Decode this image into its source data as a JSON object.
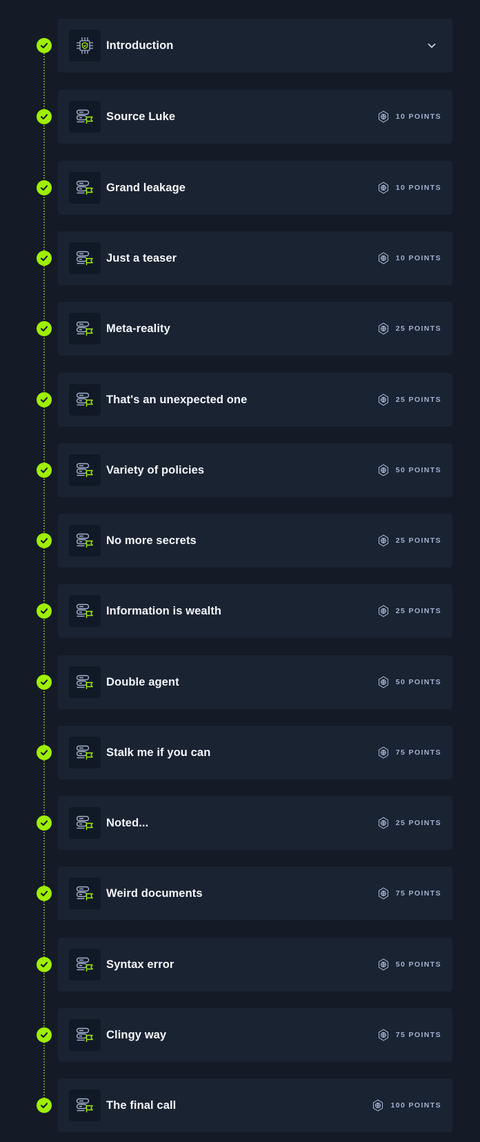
{
  "modules": [
    {
      "title": "Introduction",
      "points": "",
      "icon": "chip-icon",
      "expandable": true
    },
    {
      "title": "Source Luke",
      "points": "10 POINTS",
      "icon": "server-flag-icon"
    },
    {
      "title": "Grand leakage",
      "points": "10 POINTS",
      "icon": "server-flag-icon"
    },
    {
      "title": "Just a teaser",
      "points": "10 POINTS",
      "icon": "server-flag-icon"
    },
    {
      "title": "Meta-reality",
      "points": "25 POINTS",
      "icon": "server-flag-icon"
    },
    {
      "title": "That's an unexpected one",
      "points": "25 POINTS",
      "icon": "server-flag-icon"
    },
    {
      "title": "Variety of policies",
      "points": "50 POINTS",
      "icon": "server-flag-icon"
    },
    {
      "title": "No more secrets",
      "points": "25 POINTS",
      "icon": "server-flag-icon"
    },
    {
      "title": "Information is wealth",
      "points": "25 POINTS",
      "icon": "server-flag-icon"
    },
    {
      "title": "Double agent",
      "points": "50 POINTS",
      "icon": "server-flag-icon"
    },
    {
      "title": "Stalk me if you can",
      "points": "75 POINTS",
      "icon": "server-flag-icon"
    },
    {
      "title": "Noted...",
      "points": "25 POINTS",
      "icon": "server-flag-icon"
    },
    {
      "title": "Weird documents",
      "points": "75 POINTS",
      "icon": "server-flag-icon"
    },
    {
      "title": "Syntax error",
      "points": "50 POINTS",
      "icon": "server-flag-icon"
    },
    {
      "title": "Clingy way",
      "points": "75 POINTS",
      "icon": "server-flag-icon"
    },
    {
      "title": "The final call",
      "points": "100 POINTS",
      "icon": "server-flag-icon"
    }
  ],
  "status": {
    "completed_icon": "check-circle-icon",
    "points_icon": "globe-points-icon",
    "expand_icon": "chevron-down-icon"
  },
  "colors": {
    "background": "#141a26",
    "card": "#1a2332",
    "icon_box": "#111927",
    "accent": "#9fef00",
    "points_text": "#a4b1cd",
    "title_text": "#f4f6f9"
  }
}
